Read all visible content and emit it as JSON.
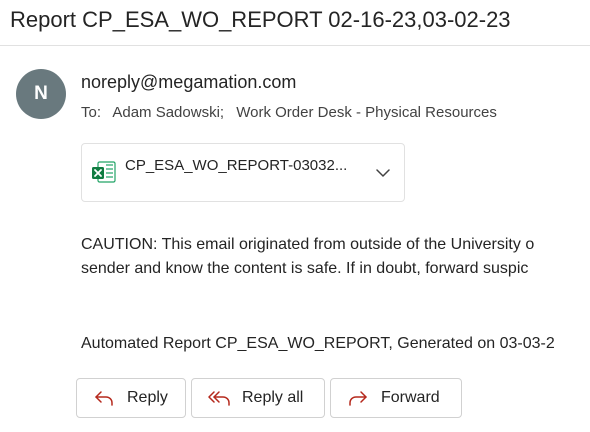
{
  "email": {
    "subject": "Report CP_ESA_WO_REPORT 02-16-23,03-02-23",
    "avatar_initial": "N",
    "sender": "noreply@megamation.com",
    "to_label": "To:",
    "recipients": [
      "Adam Sadowski;",
      "Work Order Desk - Physical Resources"
    ],
    "attachment": {
      "name": "CP_ESA_WO_REPORT-03032...",
      "icon": "excel-file-icon"
    },
    "body": {
      "caution_line_1": "CAUTION: This email originated from outside of the University o",
      "caution_line_2": "sender and know the content is safe. If in doubt, forward suspic",
      "report_line": "Automated Report CP_ESA_WO_REPORT, Generated on 03-03-2"
    }
  },
  "actions": {
    "reply": "Reply",
    "reply_all": "Reply all",
    "forward": "Forward"
  },
  "colors": {
    "avatar_bg": "#69797e",
    "excel_green": "#107c41",
    "icon_red": "#b5281c"
  }
}
